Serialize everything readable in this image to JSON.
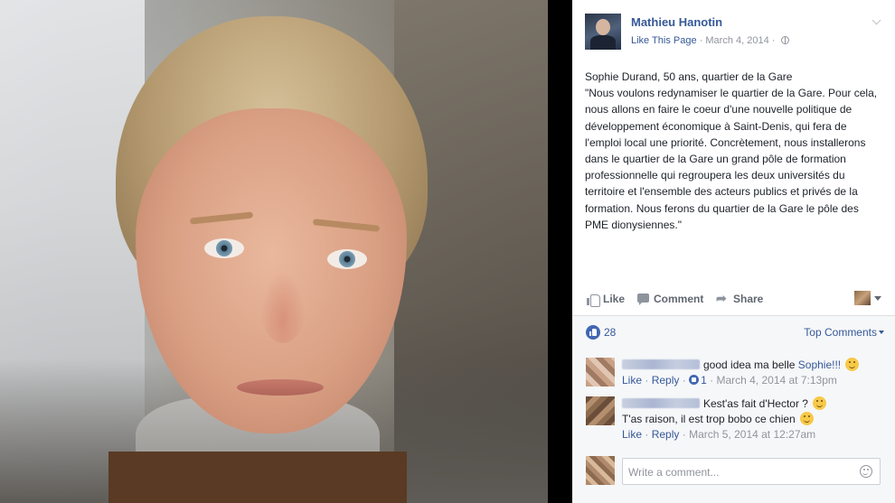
{
  "post": {
    "author": "Mathieu Hanotin",
    "like_page": "Like This Page",
    "date": "March 4, 2014",
    "text": "Sophie Durand, 50 ans, quartier de la Gare\n\"Nous voulons redynamiser le quartier de la Gare. Pour cela, nous allons en faire le coeur d'une nouvelle politique de développement économique à Saint-Denis, qui fera de l'emploi local une priorité. Concrètement, nous installerons dans le quartier de la Gare un grand pôle de formation professionnelle qui regroupera les deux universités du territoire et l'ensemble des acteurs publics et privés de la formation. Nous ferons du quartier de la Gare le pôle des PME dionysiennes.\""
  },
  "actions": {
    "like": "Like",
    "comment": "Comment",
    "share": "Share"
  },
  "reactions": {
    "count": "28",
    "sort": "Top Comments"
  },
  "comments": [
    {
      "text": "good idea ma belle",
      "mention": "Sophie!!!",
      "like": "Like",
      "reply": "Reply",
      "likes": "1",
      "date": "March 4, 2014 at 7:13pm"
    },
    {
      "line1": "Kest'as fait d'Hector ?",
      "line2": "T'as raison, il est trop bobo ce chien",
      "like": "Like",
      "reply": "Reply",
      "date": "March 5, 2014 at 12:27am"
    }
  ],
  "composer": {
    "placeholder": "Write a comment..."
  },
  "icons": {
    "avatar": "profile-photo",
    "globe": "globe-icon",
    "like": "thumbs-up-icon",
    "comment": "speech-bubble-icon",
    "share": "share-arrow-icon",
    "emoji": "smiley-emoji-icon"
  },
  "colors": {
    "link": "#365899",
    "muted": "#90949c",
    "like_blue": "#4267b2",
    "panel_bg": "#ffffff",
    "comments_bg": "#f6f7f9"
  }
}
